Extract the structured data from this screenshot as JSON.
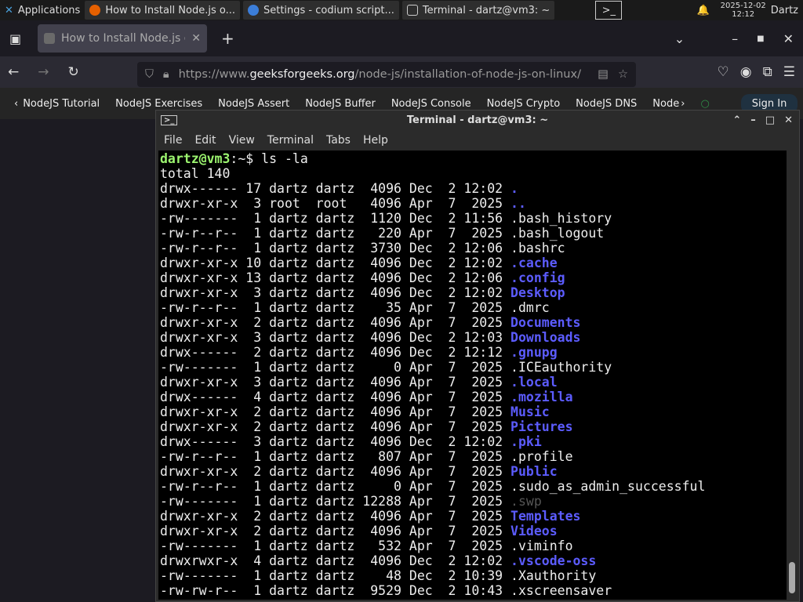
{
  "panel": {
    "apps": "Applications",
    "tasks": [
      "How to Install Node.js o...",
      "Settings - codium script...",
      "Terminal - dartz@vm3: ~"
    ],
    "date": "2025-12-02",
    "time": "12:12",
    "user": "Dartz"
  },
  "browser": {
    "tab_title": "How to Install Node.js or",
    "url_prefix": "https://www.",
    "url_domain": "geeksforgeeks.org",
    "url_path": "/node-js/installation-of-node-js-on-linux/",
    "bookmarks": [
      "NodeJS Tutorial",
      "NodeJS Exercises",
      "NodeJS Assert",
      "NodeJS Buffer",
      "NodeJS Console",
      "NodeJS Crypto",
      "NodeJS DNS",
      "Node"
    ],
    "signin": "Sign In"
  },
  "terminal": {
    "title": "Terminal - dartz@vm3: ~",
    "menu": [
      "File",
      "Edit",
      "View",
      "Terminal",
      "Tabs",
      "Help"
    ],
    "prompt_user": "dartz@vm3",
    "prompt_path": ":~$ ",
    "command": "ls -la",
    "total": "total 140",
    "rows": [
      [
        "drwx------ 17 dartz dartz  4096 Dec  2 12:02 ",
        ".",
        "dir"
      ],
      [
        "drwxr-xr-x  3 root  root   4096 Apr  7  2025 ",
        "..",
        "dir"
      ],
      [
        "-rw-------  1 dartz dartz  1120 Dec  2 11:56 ",
        ".bash_history",
        "file"
      ],
      [
        "-rw-r--r--  1 dartz dartz   220 Apr  7  2025 ",
        ".bash_logout",
        "file"
      ],
      [
        "-rw-r--r--  1 dartz dartz  3730 Dec  2 12:06 ",
        ".bashrc",
        "file"
      ],
      [
        "drwxr-xr-x 10 dartz dartz  4096 Dec  2 12:02 ",
        ".cache",
        "dir"
      ],
      [
        "drwxr-xr-x 13 dartz dartz  4096 Dec  2 12:06 ",
        ".config",
        "dir"
      ],
      [
        "drwxr-xr-x  3 dartz dartz  4096 Dec  2 12:02 ",
        "Desktop",
        "dir"
      ],
      [
        "-rw-r--r--  1 dartz dartz    35 Apr  7  2025 ",
        ".dmrc",
        "file"
      ],
      [
        "drwxr-xr-x  2 dartz dartz  4096 Apr  7  2025 ",
        "Documents",
        "dir"
      ],
      [
        "drwxr-xr-x  3 dartz dartz  4096 Dec  2 12:03 ",
        "Downloads",
        "dir"
      ],
      [
        "drwx------  2 dartz dartz  4096 Dec  2 12:12 ",
        ".gnupg",
        "dir"
      ],
      [
        "-rw-------  1 dartz dartz     0 Apr  7  2025 ",
        ".ICEauthority",
        "file"
      ],
      [
        "drwxr-xr-x  3 dartz dartz  4096 Apr  7  2025 ",
        ".local",
        "dir"
      ],
      [
        "drwx------  4 dartz dartz  4096 Apr  7  2025 ",
        ".mozilla",
        "dir"
      ],
      [
        "drwxr-xr-x  2 dartz dartz  4096 Apr  7  2025 ",
        "Music",
        "dir"
      ],
      [
        "drwxr-xr-x  2 dartz dartz  4096 Apr  7  2025 ",
        "Pictures",
        "dir"
      ],
      [
        "drwx------  3 dartz dartz  4096 Dec  2 12:02 ",
        ".pki",
        "dir"
      ],
      [
        "-rw-r--r--  1 dartz dartz   807 Apr  7  2025 ",
        ".profile",
        "file"
      ],
      [
        "drwxr-xr-x  2 dartz dartz  4096 Apr  7  2025 ",
        "Public",
        "dir"
      ],
      [
        "-rw-r--r--  1 dartz dartz     0 Apr  7  2025 ",
        ".sudo_as_admin_successful",
        "file"
      ],
      [
        "-rw-------  1 dartz dartz 12288 Apr  7  2025 ",
        ".swp",
        "dim"
      ],
      [
        "drwxr-xr-x  2 dartz dartz  4096 Apr  7  2025 ",
        "Templates",
        "dir"
      ],
      [
        "drwxr-xr-x  2 dartz dartz  4096 Apr  7  2025 ",
        "Videos",
        "dir"
      ],
      [
        "-rw-------  1 dartz dartz   532 Apr  7  2025 ",
        ".viminfo",
        "file"
      ],
      [
        "drwxrwxr-x  4 dartz dartz  4096 Dec  2 12:02 ",
        ".vscode-oss",
        "dir"
      ],
      [
        "-rw-------  1 dartz dartz    48 Dec  2 10:39 ",
        ".Xauthority",
        "file"
      ],
      [
        "-rw-rw-r--  1 dartz dartz  9529 Dec  2 10:43 ",
        ".xscreensaver",
        "file"
      ]
    ]
  },
  "colors": {
    "dir": "#5c5cff",
    "prompt": "#9cf56f",
    "swap": "#555555"
  }
}
